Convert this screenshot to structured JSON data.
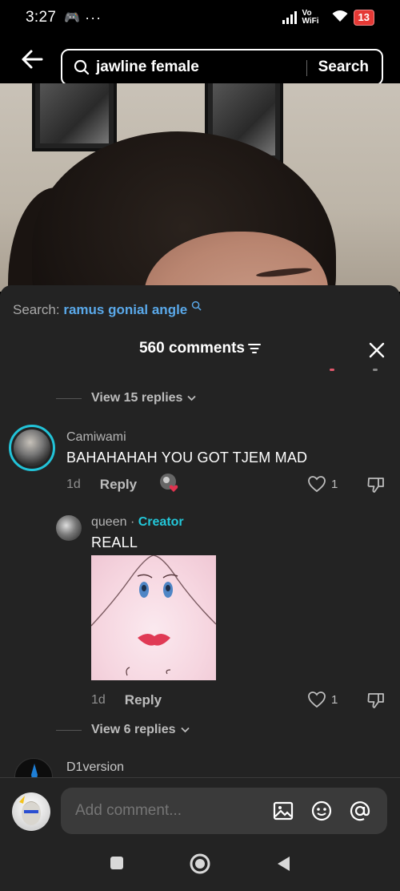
{
  "status_bar": {
    "time": "3:27",
    "signal_label": "Vo WiFi",
    "battery": "13"
  },
  "search": {
    "query": "jawline female",
    "button_label": "Search"
  },
  "sheet": {
    "search_prefix": "Search:",
    "search_term": "ramus gonial angle",
    "comment_count": "560 comments"
  },
  "comments": {
    "view_replies_top": "View 15 replies",
    "c1": {
      "user": "Camiwami",
      "text": "BAHAHAHAH YOU GOT TJEM MAD",
      "age": "1d",
      "reply_label": "Reply",
      "likes": "1"
    },
    "c2": {
      "user": "queen",
      "separator": "·",
      "badge": "Creator",
      "text": "REALL",
      "age": "1d",
      "reply_label": "Reply",
      "likes": "1"
    },
    "view_replies_bottom": "View 6 replies",
    "c3": {
      "user": "D1version"
    }
  },
  "composer": {
    "placeholder": "Add comment..."
  },
  "colors": {
    "accent_cyan": "#23c7d9",
    "link_blue": "#5aa9ea",
    "sheet_bg": "#232323"
  }
}
